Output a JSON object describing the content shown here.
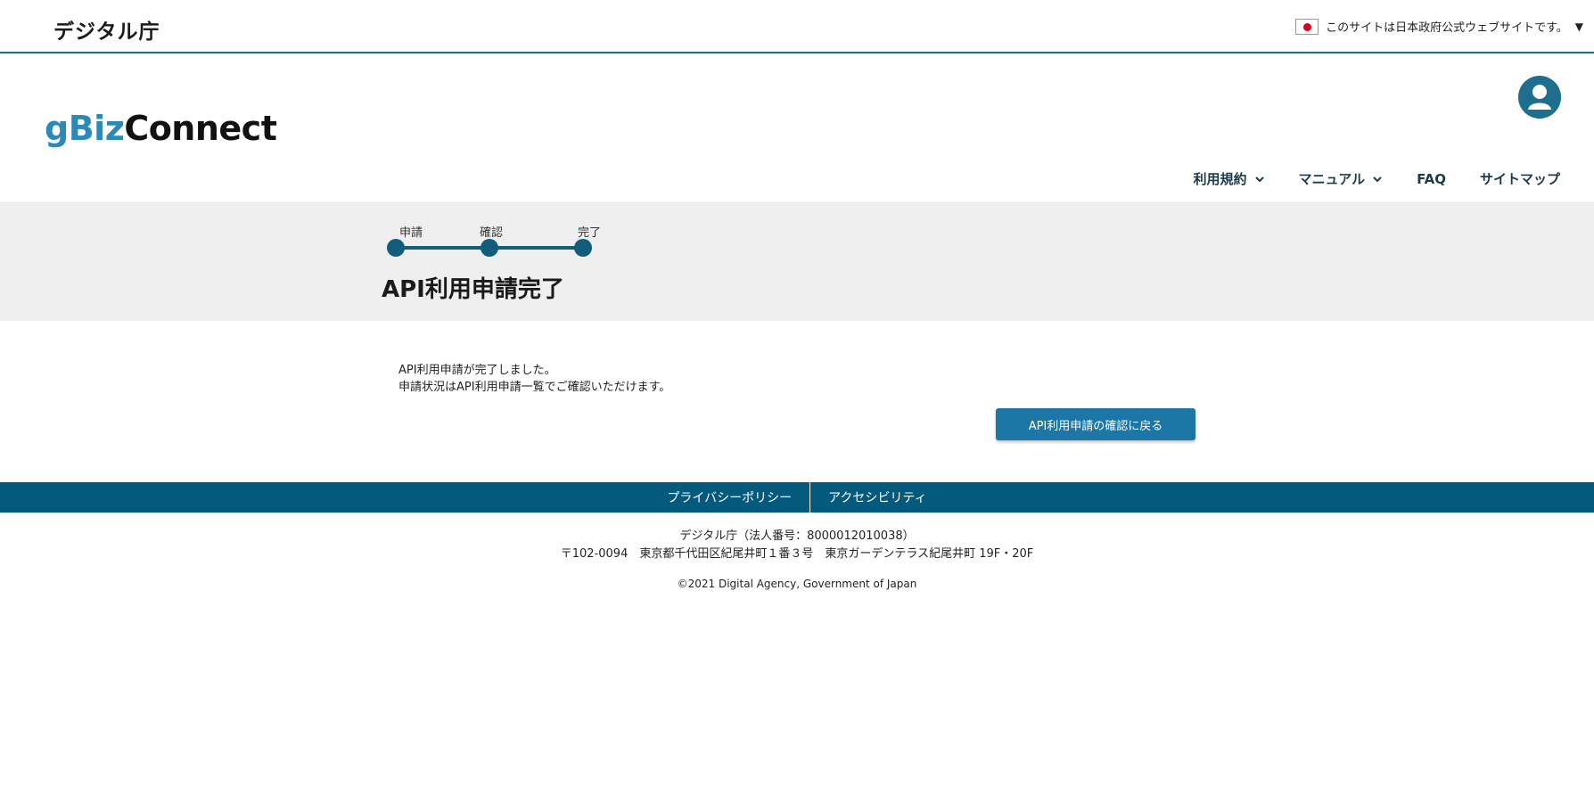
{
  "gov_bar": {
    "title": "デジタル庁",
    "notice": "このサイトは日本政府公式ウェブサイトです。",
    "caret": "▼"
  },
  "header": {
    "logo_part1": "gBiz",
    "logo_part2": "Connect",
    "nav": [
      {
        "label": "利用規約",
        "has_dropdown": true
      },
      {
        "label": "マニュアル",
        "has_dropdown": true
      },
      {
        "label": "FAQ",
        "has_dropdown": false
      },
      {
        "label": "サイトマップ",
        "has_dropdown": false
      }
    ],
    "icons": {
      "avatar": "user-avatar-icon"
    }
  },
  "steps": [
    {
      "label": "申請"
    },
    {
      "label": "確認"
    },
    {
      "label": "完了"
    }
  ],
  "page_title": "API利用申請完了",
  "main": {
    "message_line1": "API利用申請が完了しました。",
    "message_line2": "申請状況はAPI利用申請一覧でご確認いただけます。",
    "back_button": "API利用申請の確認に戻る"
  },
  "footer": {
    "links": [
      "プライバシーポリシー",
      "アクセシビリティ"
    ],
    "org_line": "デジタル庁（法人番号：8000012010038）",
    "address_line": "〒102-0094　東京都千代田区紀尾井町１番３号　東京ガーデンテラス紀尾井町 19F・20F",
    "copyright": "©2021 Digital Agency, Government of Japan"
  },
  "colors": {
    "primary": "#045a7d",
    "button": "#1d77a6",
    "logo_accent": "#2b8ab7",
    "step": "#125d7c",
    "band": "#efefef"
  }
}
